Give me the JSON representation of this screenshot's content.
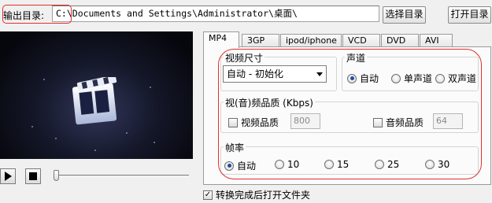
{
  "output": {
    "label": "输出目录:",
    "path": "C:\\Documents and Settings\\Administrator\\桌面\\",
    "choose_button": "选择目录",
    "open_button": "打开目录"
  },
  "tabs": [
    "MP4",
    "3GP",
    "ipod/iphone",
    "VCD",
    "DVD",
    "AVI"
  ],
  "active_tab": "MP4",
  "video_size": {
    "title": "视频尺寸",
    "selected": "自动 - 初始化"
  },
  "audio_channel": {
    "title": "声道",
    "options": [
      "自动",
      "单声道",
      "双声道"
    ],
    "selected": "自动"
  },
  "quality": {
    "title": "视(音)频品质 (Kbps)",
    "video_label": "视频品质",
    "video_value": "800",
    "audio_label": "音频品质",
    "audio_value": "64"
  },
  "frame_rate": {
    "title": "帧率",
    "options": [
      "自动",
      "10",
      "15",
      "25",
      "30"
    ],
    "selected": "自动"
  },
  "open_after": {
    "label": "转换完成后打开文件夹",
    "checked": true
  },
  "colors": {
    "annotation_red": "#e03030",
    "preview_background": "#0b0d18"
  }
}
